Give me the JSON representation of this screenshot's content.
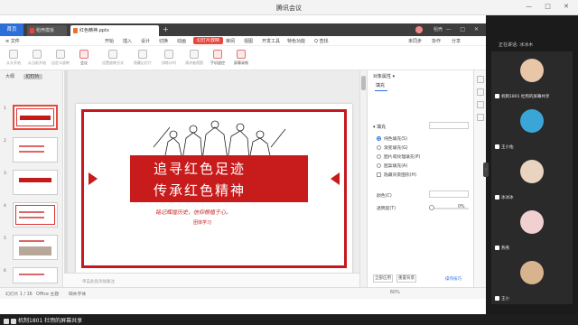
{
  "meeting": {
    "title": "腾讯会议",
    "speaking": "正在讲话: 冰冰木",
    "participants": [
      {
        "name": "机制1801 杜煦的屏幕共享",
        "avatar_color": "#e8c6a8"
      },
      {
        "name": "王小佑",
        "avatar_color": "#3aa6d8"
      },
      {
        "name": "冰冰冰",
        "avatar_color": "#e8d4c0"
      },
      {
        "name": "燕燕",
        "avatar_color": "#f0d0d0"
      },
      {
        "name": "王小",
        "avatar_color": "#d8b48e"
      }
    ],
    "bottom_label": "机制1801 杜煦的屏幕共享"
  },
  "wps": {
    "tabs": {
      "home": "首页",
      "templates": "稻壳模板",
      "file": "红色精神.pptx",
      "account": "稻壳"
    },
    "menu": {
      "file": "≡ 文件",
      "items": [
        "开始",
        "插入",
        "设计",
        "切换",
        "动画",
        "幻灯片放映",
        "审阅",
        "视图",
        "开发工具",
        "特色功能"
      ],
      "active": "幻灯片放映",
      "search": "Q 查找",
      "right": [
        "未同步",
        "协作",
        "分享"
      ]
    },
    "toolbar": [
      {
        "label": "从头开始",
        "strong": false
      },
      {
        "label": "从当前开始",
        "strong": false
      },
      {
        "label": "自定义放映",
        "strong": false
      },
      {
        "label": "会议",
        "strong": true
      },
      {
        "label": "设置放映方式",
        "strong": false
      },
      {
        "label": "隐藏幻灯片",
        "strong": false
      },
      {
        "label": "排练计时",
        "strong": false
      },
      {
        "label": "演讲者视图",
        "strong": false
      },
      {
        "label": "手机遥控",
        "strong": true
      },
      {
        "label": "屏幕录制",
        "strong": true
      }
    ],
    "left_panel": {
      "tabs": [
        "大纲",
        "幻灯片"
      ],
      "slides": [
        "1",
        "2",
        "3",
        "4",
        "5",
        "6"
      ]
    },
    "slide": {
      "title1": "追寻红色足迹",
      "title2": "传承红色精神",
      "subtitle": "铭记辉煌历史，信仰根植于心。",
      "team": "团体学习"
    },
    "notes_placeholder": "单击此处添加备注",
    "properties": {
      "header": "对象属性 ▾",
      "tab": "填充",
      "section": "▾ 填充",
      "options": [
        {
          "label": "纯色填充(S)",
          "checked": true
        },
        {
          "label": "渐变填充(G)",
          "checked": false
        },
        {
          "label": "图片或纹理填充(P)",
          "checked": false
        },
        {
          "label": "图案填充(A)",
          "checked": false
        },
        {
          "label": "隐藏背景图形(H)",
          "checked": false,
          "checkbox": true
        }
      ],
      "color_label": "颜色(C)",
      "transparency_label": "透明度(T)",
      "transparency_value": "0%",
      "apply_all": "全部应用",
      "reset": "重置背景",
      "more": "操作技巧"
    },
    "status": {
      "slide_pos": "幻灯片 1 / 16",
      "theme": "Office 主题",
      "missing_font": "缺失字体",
      "zoom": "60%"
    }
  },
  "colors": {
    "accent_red": "#c81b1b",
    "brand_blue": "#2c6fd8"
  }
}
